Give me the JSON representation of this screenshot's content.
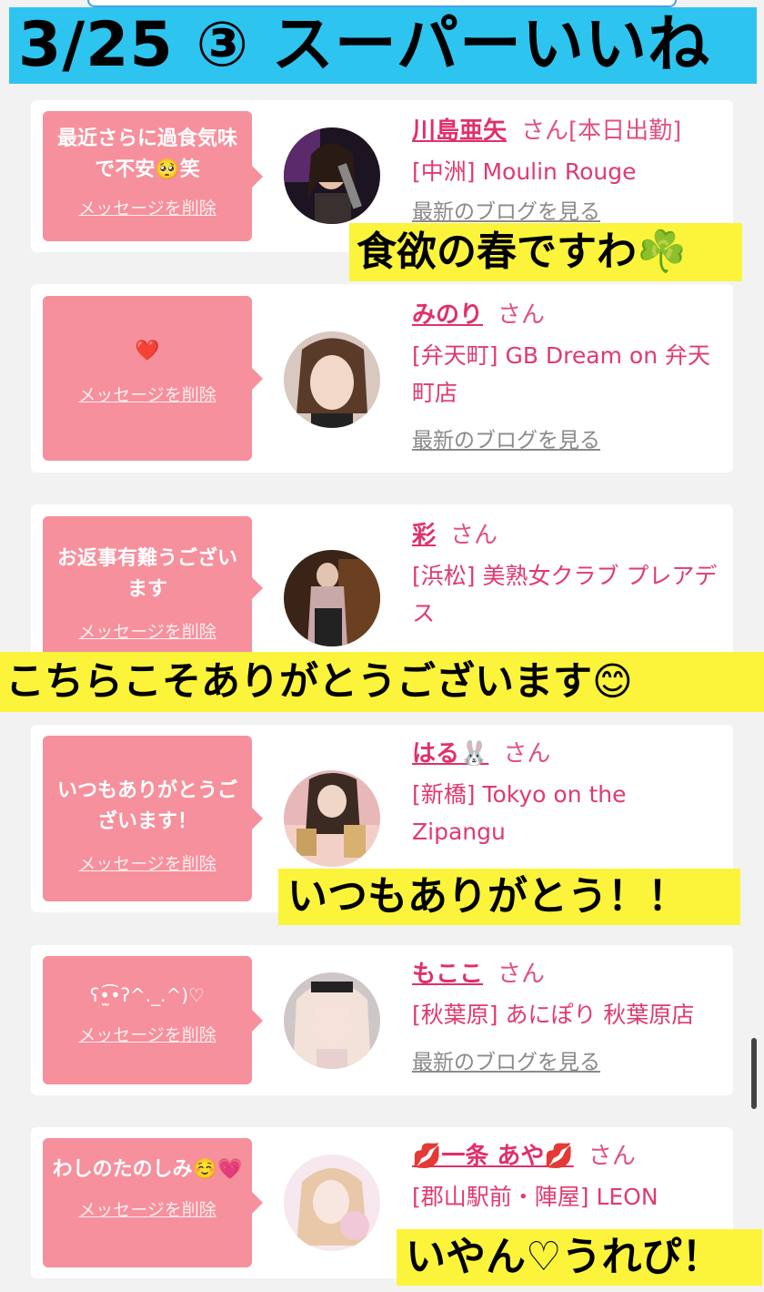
{
  "banner": {
    "title": "3/25 ③ スーパーいいね"
  },
  "common": {
    "delete_label": "メッセージを削除",
    "blog_label": "最新のブログを見る",
    "san_label": "さん"
  },
  "cards": [
    {
      "message": "最近さらに過食気味で不安🥺笑",
      "name": "川島亜矢",
      "status": "[本日出勤]",
      "shop": "[中洲] Moulin Rouge",
      "has_blog": true
    },
    {
      "message": "❤️",
      "name": "みのり",
      "status": "",
      "shop": "[弁天町] GB Dream on 弁天町店",
      "has_blog": true
    },
    {
      "message": "お返事有難うございます",
      "name": "彩",
      "status": "",
      "shop": "[浜松] 美熟女クラブ プレアデス",
      "has_blog": false
    },
    {
      "message": "いつもありがとうございます！",
      "name": "はる🐰",
      "status": "",
      "shop": "[新橋] Tokyo on the Zipangu",
      "has_blog": false
    },
    {
      "message": "ʕ•̫͡•ʔ^._.^)♡",
      "name": "もここ",
      "status": "",
      "shop": "[秋葉原] あにぽり 秋葉原店",
      "has_blog": true
    },
    {
      "message": "わしのたのしみ☺️💗",
      "name": "💋一条 あや💋",
      "status": "",
      "shop": "[郡山駅前・陣屋] LEON",
      "has_blog": false
    }
  ],
  "overlays": {
    "o1": "食欲の春ですわ☘️",
    "o2": "こちらこそありがとうございます😊",
    "o3": "いつもありがとう！！",
    "o4": "いやん♡うれぴ！"
  },
  "colors": {
    "banner": "#2ec4f0",
    "bubble": "#f6909c",
    "name": "#e0306a",
    "overlay": "#fbf43a"
  }
}
